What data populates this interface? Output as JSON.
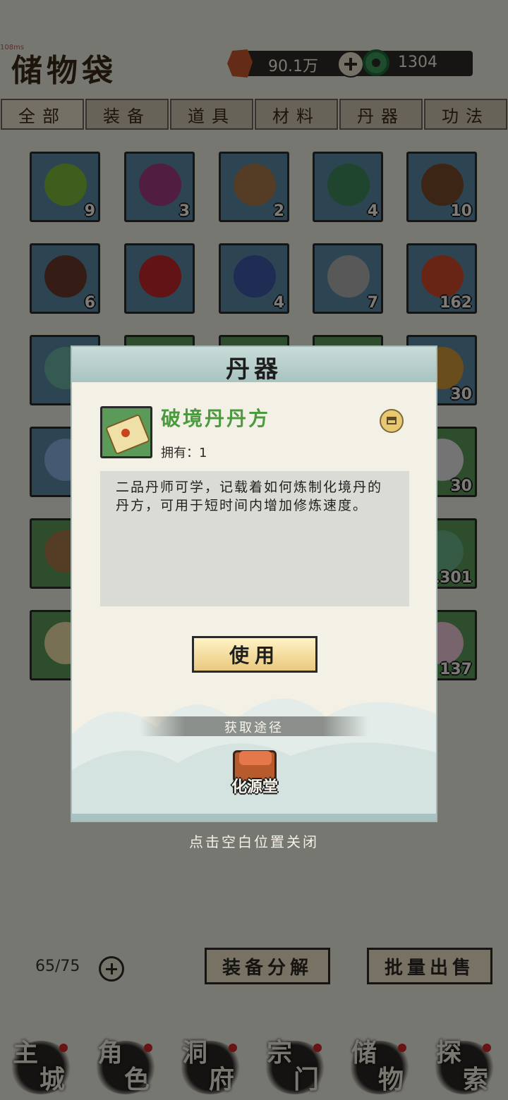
{
  "header": {
    "debug_text": "108ms",
    "title": "储物袋",
    "spirit_stone": "90.1万",
    "jade": "1304"
  },
  "tabs": [
    {
      "label": "全部",
      "active": true
    },
    {
      "label": "装备",
      "active": false
    },
    {
      "label": "道具",
      "active": false
    },
    {
      "label": "材料",
      "active": false
    },
    {
      "label": "丹器",
      "active": false
    },
    {
      "label": "功法",
      "active": false
    }
  ],
  "inventory": [
    {
      "count": "9",
      "color": "#5a8aa4",
      "glyph": "#7fba3a"
    },
    {
      "count": "3",
      "color": "#5a8aa4",
      "glyph": "#a23a82"
    },
    {
      "count": "2",
      "color": "#5a8aa4",
      "glyph": "#a8794a"
    },
    {
      "count": "4",
      "color": "#5a8aa4",
      "glyph": "#3f8a5e"
    },
    {
      "count": "10",
      "color": "#5a8aa4",
      "glyph": "#7a4a2a"
    },
    {
      "count": "6",
      "color": "#5a8aa4",
      "glyph": "#6a3a2a"
    },
    {
      "count": "",
      "color": "#5a8aa4",
      "glyph": "#c4282a"
    },
    {
      "count": "4",
      "color": "#5a8aa4",
      "glyph": "#3e58a8"
    },
    {
      "count": "7",
      "color": "#5a8aa4",
      "glyph": "#b0b0b0"
    },
    {
      "count": "162",
      "color": "#5a8aa4",
      "glyph": "#d04a2a"
    },
    {
      "count": "",
      "color": "#5a8aa4",
      "glyph": "#6ab4a4"
    },
    {
      "count": "30",
      "color": "#5a8aa4",
      "glyph": "#d49a3a"
    },
    {
      "count": "",
      "color": "#5a8aa4",
      "glyph": "#8ab4e4"
    },
    {
      "count": "30",
      "color": "#5b9a58",
      "glyph": "#e8e8e8"
    },
    {
      "count": "",
      "color": "#5b9a58",
      "glyph": "#a8794a"
    },
    {
      "count": "1301",
      "color": "#5b9a58",
      "glyph": "#6ab48a"
    },
    {
      "count": "",
      "color": "#5b9a58",
      "glyph": "#efe0a8"
    },
    {
      "count": "137",
      "color": "#5b9a58",
      "glyph": "#f0c8d8"
    },
    {
      "count": "",
      "color": "#5a8aa4",
      "glyph": "#a8794a"
    },
    {
      "count": "3",
      "color": "#5b9a58",
      "glyph": "#5ab43a"
    }
  ],
  "footer": {
    "capacity": "65/75",
    "decompose_button": "装备分解",
    "bulk_sell_button": "批量出售"
  },
  "nav": [
    {
      "c1": "主",
      "c2": "城",
      "icon": "main-city-icon"
    },
    {
      "c1": "角",
      "c2": "色",
      "icon": "character-icon"
    },
    {
      "c1": "洞",
      "c2": "府",
      "icon": "cave-icon"
    },
    {
      "c1": "宗",
      "c2": "门",
      "icon": "sect-icon"
    },
    {
      "c1": "储",
      "c2": "物",
      "icon": "storage-icon"
    },
    {
      "c1": "探",
      "c2": "索",
      "icon": "explore-icon"
    }
  ],
  "modal": {
    "title": "丹器",
    "item_name": "破境丹丹方",
    "owned": "拥有：1",
    "description": "二品丹师可学，记载着如何炼制化境丹的丹方，可用于短时间内增加修炼速度。",
    "use_button": "使用",
    "source_title": "获取途径",
    "source_name": "化源堂",
    "close_hint": "点击空白位置关闭"
  }
}
